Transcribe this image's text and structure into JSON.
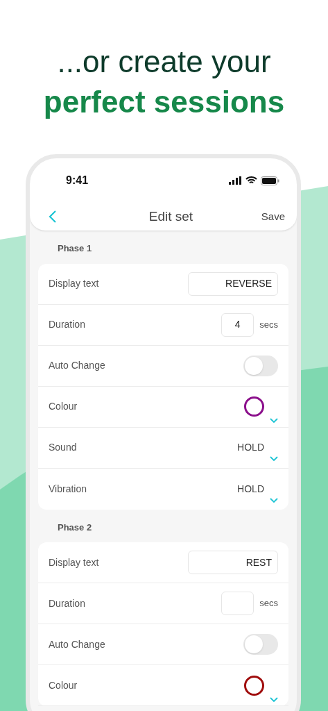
{
  "headline": {
    "line_1": "...or create your",
    "line_2": "perfect sessions"
  },
  "status_bar": {
    "time": "9:41"
  },
  "nav": {
    "title": "Edit set",
    "action": "Save"
  },
  "phases": [
    {
      "title": "Phase 1",
      "rows": [
        {
          "kind": "text",
          "label": "Display text",
          "value": "REVERSE"
        },
        {
          "kind": "number",
          "label": "Duration",
          "value": "4",
          "suffix": "secs"
        },
        {
          "kind": "toggle",
          "label": "Auto Change",
          "on": false
        },
        {
          "kind": "colour",
          "label": "Colour",
          "color": "#8b0f8b"
        },
        {
          "kind": "select",
          "label": "Sound",
          "value": "HOLD"
        },
        {
          "kind": "select",
          "label": "Vibration",
          "value": "HOLD"
        }
      ]
    },
    {
      "title": "Phase 2",
      "rows": [
        {
          "kind": "text",
          "label": "Display text",
          "value": "REST"
        },
        {
          "kind": "number",
          "label": "Duration",
          "suffix": "secs"
        },
        {
          "kind": "toggle",
          "label": "Auto Change",
          "on": false
        },
        {
          "kind": "colour",
          "label": "Colour",
          "color": "#a00d0d"
        }
      ]
    }
  ]
}
